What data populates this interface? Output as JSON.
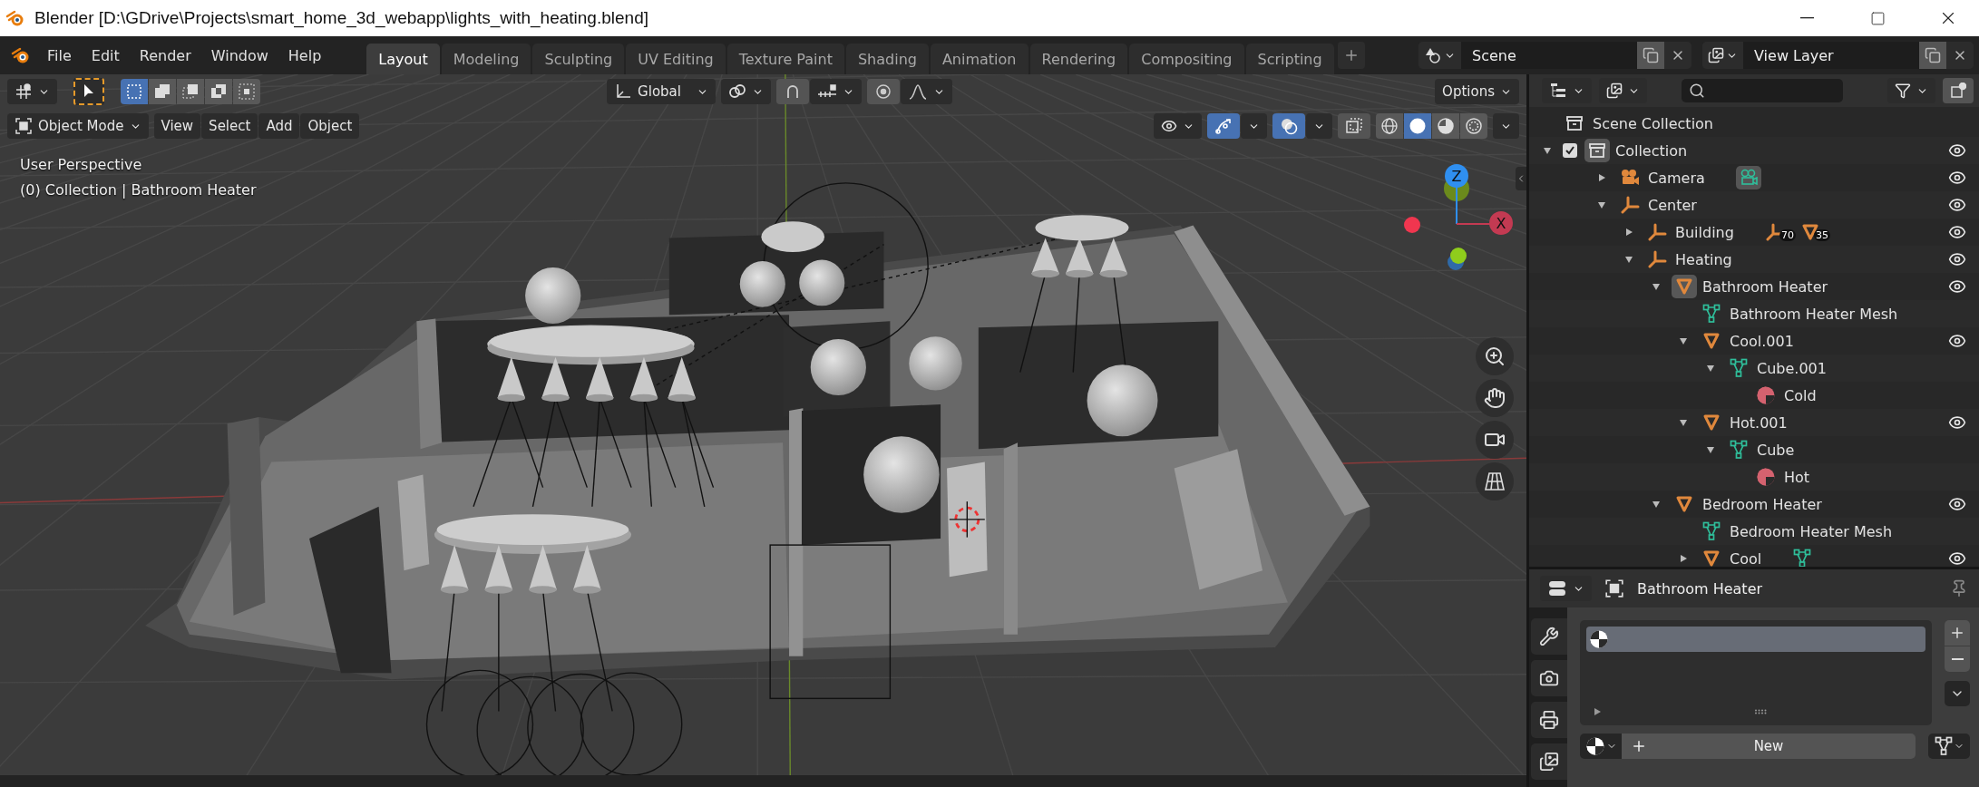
{
  "window": {
    "title": "Blender [D:\\GDrive\\Projects\\smart_home_3d_webapp\\lights_with_heating.blend]"
  },
  "menu": [
    "File",
    "Edit",
    "Render",
    "Window",
    "Help"
  ],
  "workspaces": [
    {
      "label": "Layout",
      "selected": true
    },
    {
      "label": "Modeling",
      "selected": false
    },
    {
      "label": "Sculpting",
      "selected": false
    },
    {
      "label": "UV Editing",
      "selected": false
    },
    {
      "label": "Texture Paint",
      "selected": false
    },
    {
      "label": "Shading",
      "selected": false
    },
    {
      "label": "Animation",
      "selected": false
    },
    {
      "label": "Rendering",
      "selected": false
    },
    {
      "label": "Compositing",
      "selected": false
    },
    {
      "label": "Scripting",
      "selected": false
    }
  ],
  "scene": "Scene",
  "view_layer": "View Layer",
  "tool_header": {
    "select_modes": [
      {
        "kind": "set",
        "selected": true
      },
      {
        "kind": "extend",
        "selected": false
      },
      {
        "kind": "subtract",
        "selected": false
      },
      {
        "kind": "difference",
        "selected": false
      },
      {
        "kind": "intersect",
        "selected": false
      }
    ],
    "orientation": "Global",
    "options": "Options"
  },
  "viewport_header": {
    "mode": "Object Mode",
    "menus": [
      "View",
      "Select",
      "Add",
      "Object"
    ],
    "toggles": [
      {
        "kind": "gizmo",
        "on": true
      },
      {
        "kind": "overlay",
        "on": true
      },
      {
        "kind": "xray",
        "on": false
      }
    ],
    "shading": [
      {
        "kind": "wireframe",
        "selected": false
      },
      {
        "kind": "solid",
        "selected": true
      },
      {
        "kind": "material",
        "selected": false
      },
      {
        "kind": "rendered",
        "selected": false
      }
    ]
  },
  "viewport": {
    "info": [
      "User Perspective",
      "(0) Collection | Bathroom Heater"
    ],
    "axes": [
      "Z",
      "X"
    ]
  },
  "outliner": {
    "root": "Scene Collection",
    "items": [
      {
        "name": "Collection",
        "kind": "collection",
        "expanded": true,
        "checked": true,
        "active": true,
        "eye": true,
        "children": [
          {
            "name": "Camera",
            "kind": "camera",
            "expanded": false,
            "active": false,
            "eye": true,
            "extras": [
              {
                "kind": "camera-data"
              }
            ]
          },
          {
            "name": "Center",
            "kind": "empty",
            "expanded": true,
            "active": false,
            "eye": true,
            "children": [
              {
                "name": "Building",
                "kind": "empty",
                "expanded": false,
                "active": false,
                "eye": true,
                "extras": [
                  {
                    "kind": "empty",
                    "count": "70"
                  },
                  {
                    "kind": "mesh-object",
                    "count": "35"
                  }
                ]
              },
              {
                "name": "Heating",
                "kind": "empty",
                "expanded": true,
                "active": false,
                "eye": true,
                "children": [
                  {
                    "name": "Bathroom Heater",
                    "kind": "mesh-object",
                    "expanded": true,
                    "active": true,
                    "eye": true,
                    "children": [
                      {
                        "name": "Bathroom Heater Mesh",
                        "kind": "mesh-data",
                        "active": false,
                        "eye": false
                      },
                      {
                        "name": "Cool.001",
                        "kind": "mesh-object",
                        "expanded": true,
                        "active": false,
                        "eye": true,
                        "children": [
                          {
                            "name": "Cube.001",
                            "kind": "mesh-data",
                            "expanded": true,
                            "active": false,
                            "eye": false,
                            "children": [
                              {
                                "name": "Cold",
                                "kind": "material",
                                "active": false,
                                "eye": false
                              }
                            ]
                          }
                        ]
                      },
                      {
                        "name": "Hot.001",
                        "kind": "mesh-object",
                        "expanded": true,
                        "active": false,
                        "eye": true,
                        "children": [
                          {
                            "name": "Cube",
                            "kind": "mesh-data",
                            "expanded": true,
                            "active": false,
                            "eye": false,
                            "children": [
                              {
                                "name": "Hot",
                                "kind": "material",
                                "active": false,
                                "eye": false
                              }
                            ]
                          }
                        ]
                      }
                    ]
                  },
                  {
                    "name": "Bedroom Heater",
                    "kind": "mesh-object",
                    "expanded": true,
                    "active": false,
                    "eye": true,
                    "children": [
                      {
                        "name": "Bedroom Heater Mesh",
                        "kind": "mesh-data",
                        "active": false,
                        "eye": false
                      },
                      {
                        "name": "Cool",
                        "kind": "mesh-object",
                        "expanded": false,
                        "active": false,
                        "eye": true,
                        "extras": [
                          {
                            "kind": "mesh-data"
                          }
                        ]
                      }
                    ]
                  }
                ]
              }
            ]
          }
        ]
      }
    ]
  },
  "properties": {
    "tabs": [
      {
        "kind": "tool"
      },
      {
        "kind": "render"
      },
      {
        "kind": "output"
      },
      {
        "kind": "view-layer"
      }
    ],
    "object": "Bathroom Heater",
    "new_label": "New"
  }
}
